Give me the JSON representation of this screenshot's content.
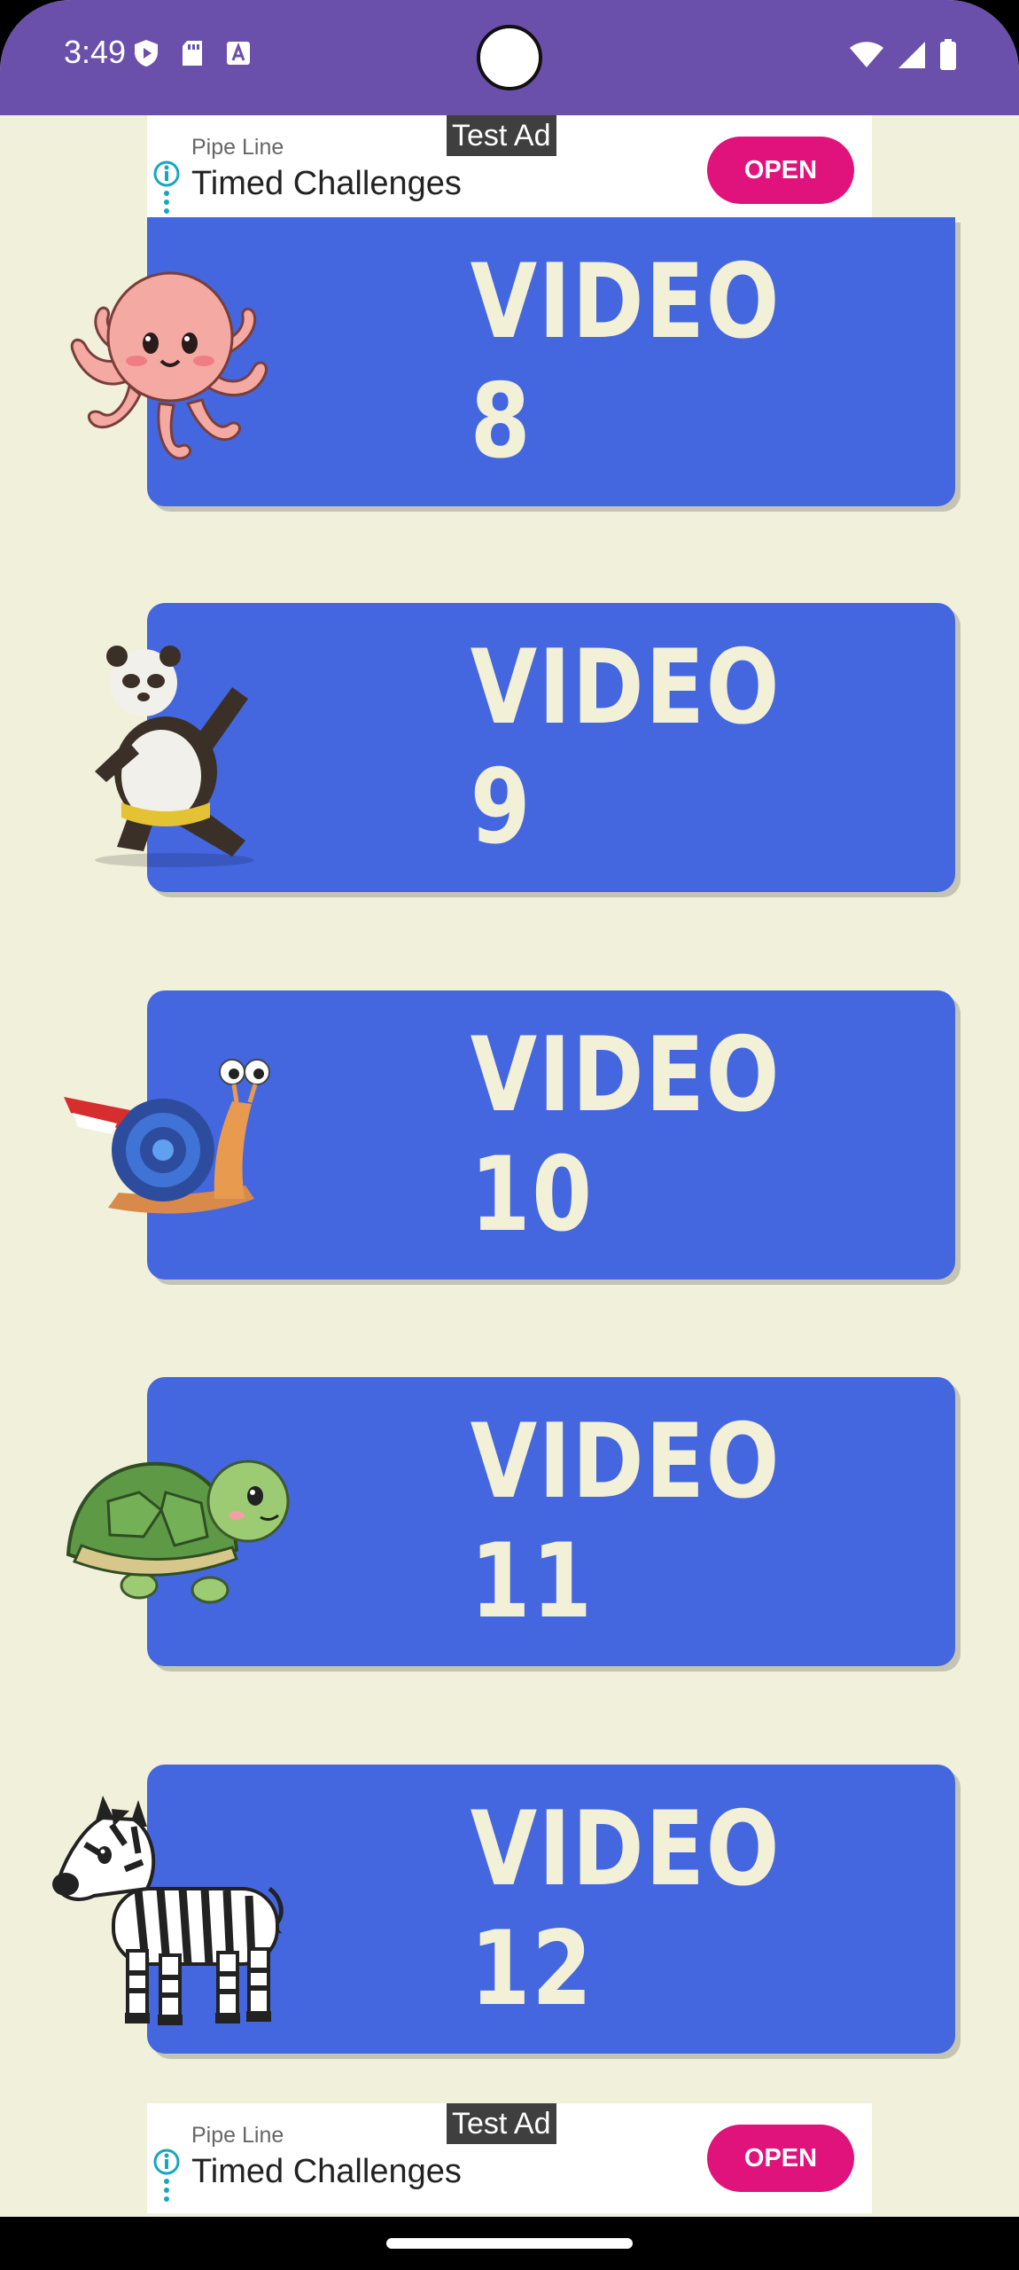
{
  "status_bar": {
    "time": "3:49",
    "icons_left": [
      "shield-icon",
      "sd-card-icon",
      "font-icon"
    ],
    "icons_right": [
      "wifi-icon",
      "cellular-signal-icon",
      "battery-icon"
    ],
    "background": "#6A4FAB"
  },
  "ads": {
    "top": {
      "tag": "Test Ad",
      "advertiser": "Pipe Line",
      "headline": "Timed Challenges",
      "cta": "OPEN"
    },
    "bottom": {
      "tag": "Test Ad",
      "advertiser": "Pipe Line",
      "headline": "Timed Challenges",
      "cta": "OPEN"
    }
  },
  "videos": [
    {
      "label": "VIDEO 8",
      "icon": "octopus-icon"
    },
    {
      "label": "VIDEO 9",
      "icon": "panda-icon"
    },
    {
      "label": "VIDEO 10",
      "icon": "snail-icon"
    },
    {
      "label": "VIDEO 11",
      "icon": "turtle-icon"
    },
    {
      "label": "VIDEO 12",
      "icon": "zebra-icon"
    }
  ],
  "colors": {
    "background": "#F1F0DB",
    "card": "#4467E0",
    "card_text": "#F3F0D8",
    "cta": "#E0127C"
  }
}
